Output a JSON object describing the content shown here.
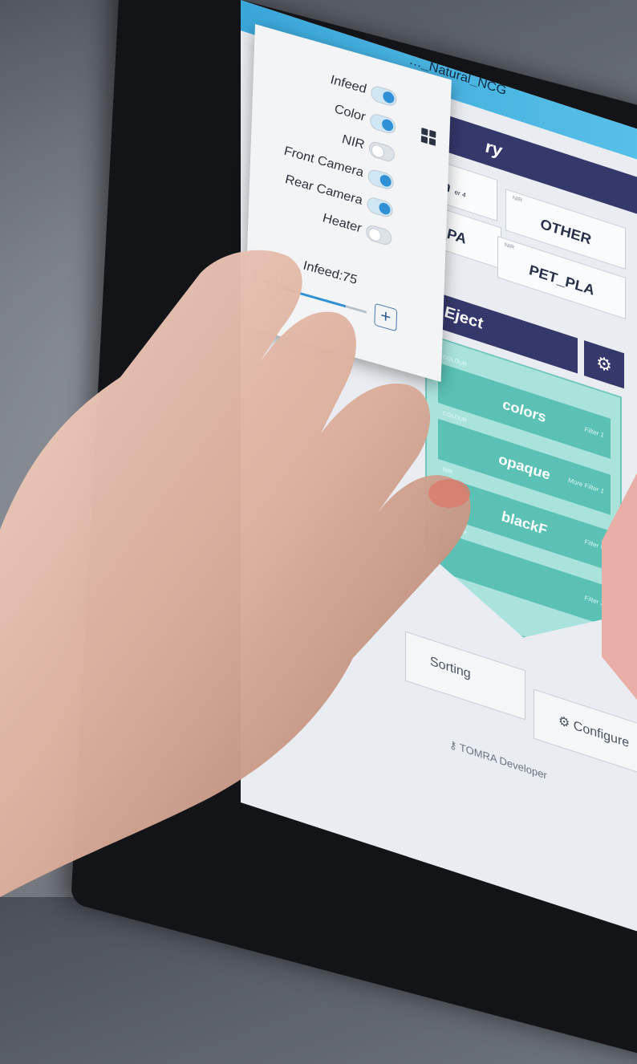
{
  "screen": {
    "topbar_title": "…_Natural_NCG",
    "category_title": "ry",
    "materials": [
      {
        "tag": "",
        "label": "on",
        "sub": "er 4"
      },
      {
        "tag": "NIR",
        "label": "OTHER"
      },
      {
        "tag": "",
        "label": "C_PA"
      },
      {
        "tag": "NIR",
        "label": "PET_PLA"
      }
    ],
    "eject": {
      "title": "Eject",
      "gear_icon": "gear-icon",
      "rows": [
        {
          "tag": "COLOUR",
          "label": "colors",
          "sub": "Filter 1"
        },
        {
          "tag": "COLOUR",
          "label": "opaque",
          "sub": "More Filter 1"
        },
        {
          "tag": "NIR",
          "label": "blackF",
          "sub": "Filter 5"
        },
        {
          "tag": "COLOUR",
          "label": "",
          "sub": "Filter 2"
        }
      ]
    },
    "bottom_buttons": {
      "sorting": "Sorting",
      "configure": "Configure"
    },
    "footer": "TOMRA Developer",
    "colors": {
      "header": "#35386b",
      "eject_bg": "#a9e3dc",
      "eject_row": "#5ac1b4",
      "accent": "#2f90d5",
      "pink": "#e9aea6"
    }
  },
  "popup": {
    "toggles": [
      {
        "label": "Infeed",
        "on": true
      },
      {
        "label": "Color",
        "on": true
      },
      {
        "label": "NIR",
        "on": false
      },
      {
        "label": "Front Camera",
        "on": true
      },
      {
        "label": "Rear Camera",
        "on": true
      },
      {
        "label": "Heater",
        "on": false
      }
    ],
    "infeed_label": "Infeed:75",
    "infeed_value": 75,
    "minus": "−",
    "plus": "+"
  }
}
